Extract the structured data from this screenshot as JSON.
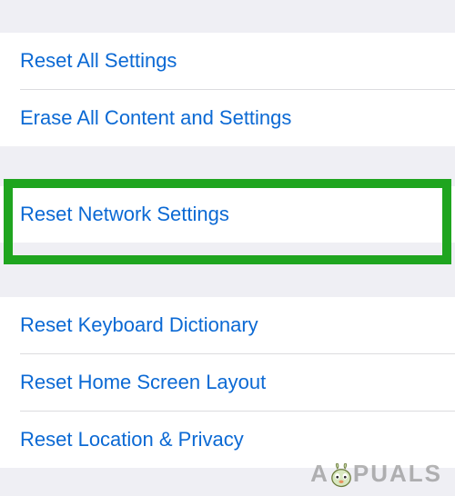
{
  "groups": [
    {
      "items": [
        {
          "label": "Reset All Settings"
        },
        {
          "label": "Erase All Content and Settings"
        }
      ]
    },
    {
      "highlighted": true,
      "items": [
        {
          "label": "Reset Network Settings"
        }
      ]
    },
    {
      "items": [
        {
          "label": "Reset Keyboard Dictionary"
        },
        {
          "label": "Reset Home Screen Layout"
        },
        {
          "label": "Reset Location & Privacy"
        }
      ]
    }
  ],
  "highlight_color": "#1fa51f",
  "link_color": "#0b69d4",
  "watermark": {
    "prefix": "A",
    "suffix": "PUALS"
  }
}
